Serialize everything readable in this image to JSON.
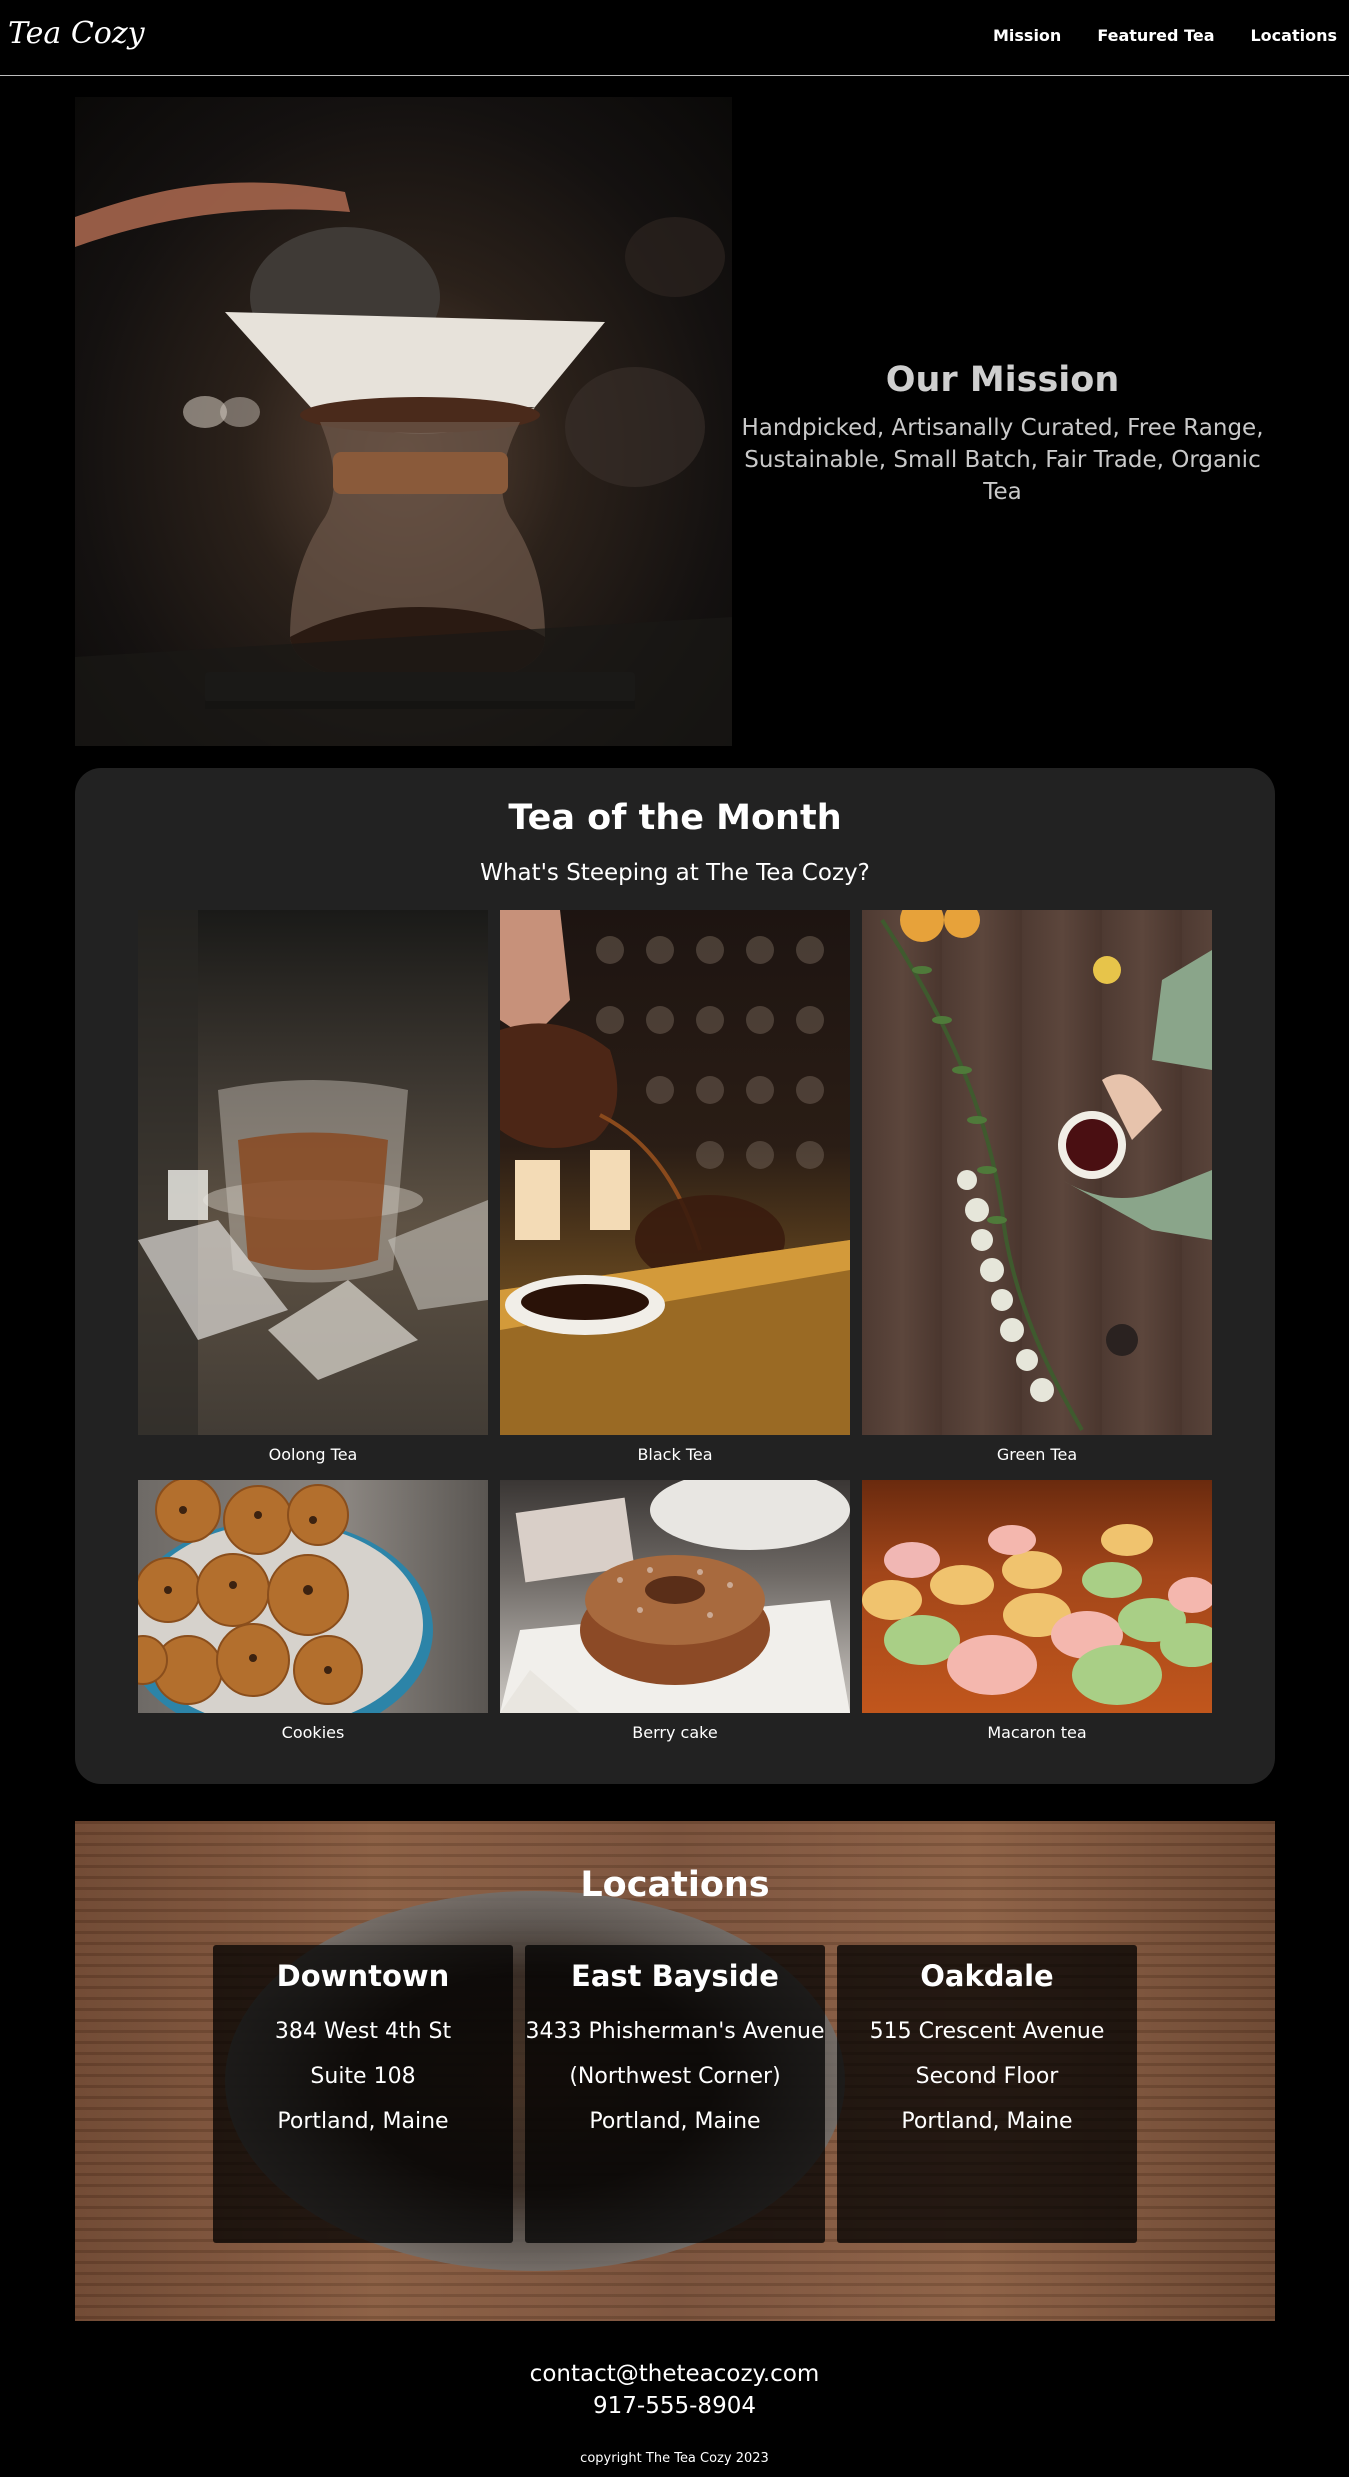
{
  "header": {
    "logo": "Tea Cozy",
    "nav": [
      "Mission",
      "Featured Tea",
      "Locations"
    ]
  },
  "mission": {
    "title": "Our Mission",
    "description": "Handpicked, Artisanally Curated, Free Range, Sustainable, Small Batch, Fair Trade, Organic Tea"
  },
  "featured": {
    "title": "Tea of the Month",
    "subtitle": "What's Steeping at The Tea Cozy?",
    "items": [
      {
        "label": "Oolong Tea",
        "icon": "tea-glass-photo"
      },
      {
        "label": "Black Tea",
        "icon": "tea-pour-photo"
      },
      {
        "label": "Green Tea",
        "icon": "green-tea-cup-photo"
      },
      {
        "label": "Cookies",
        "icon": "cookies-photo"
      },
      {
        "label": "Berry cake",
        "icon": "berry-cake-photo"
      },
      {
        "label": "Macaron tea",
        "icon": "macarons-photo"
      }
    ]
  },
  "locations": {
    "title": "Locations",
    "items": [
      {
        "name": "Downtown",
        "lines": [
          "384 West 4th St",
          "Suite 108",
          "Portland, Maine"
        ]
      },
      {
        "name": "East Bayside",
        "lines": [
          "3433 Phisherman's Avenue",
          "(Northwest Corner)",
          "Portland, Maine"
        ]
      },
      {
        "name": "Oakdale",
        "lines": [
          "515 Crescent Avenue",
          "Second Floor",
          "Portland, Maine"
        ]
      }
    ]
  },
  "footer": {
    "email": "contact@theteacozy.com",
    "phone": "917-555-8904",
    "copyright": "copyright The Tea Cozy 2023"
  },
  "colors": {
    "background": "#000000",
    "card_background": "#222222",
    "text": "#ffffff",
    "muted_text": "#cfcfcf"
  }
}
